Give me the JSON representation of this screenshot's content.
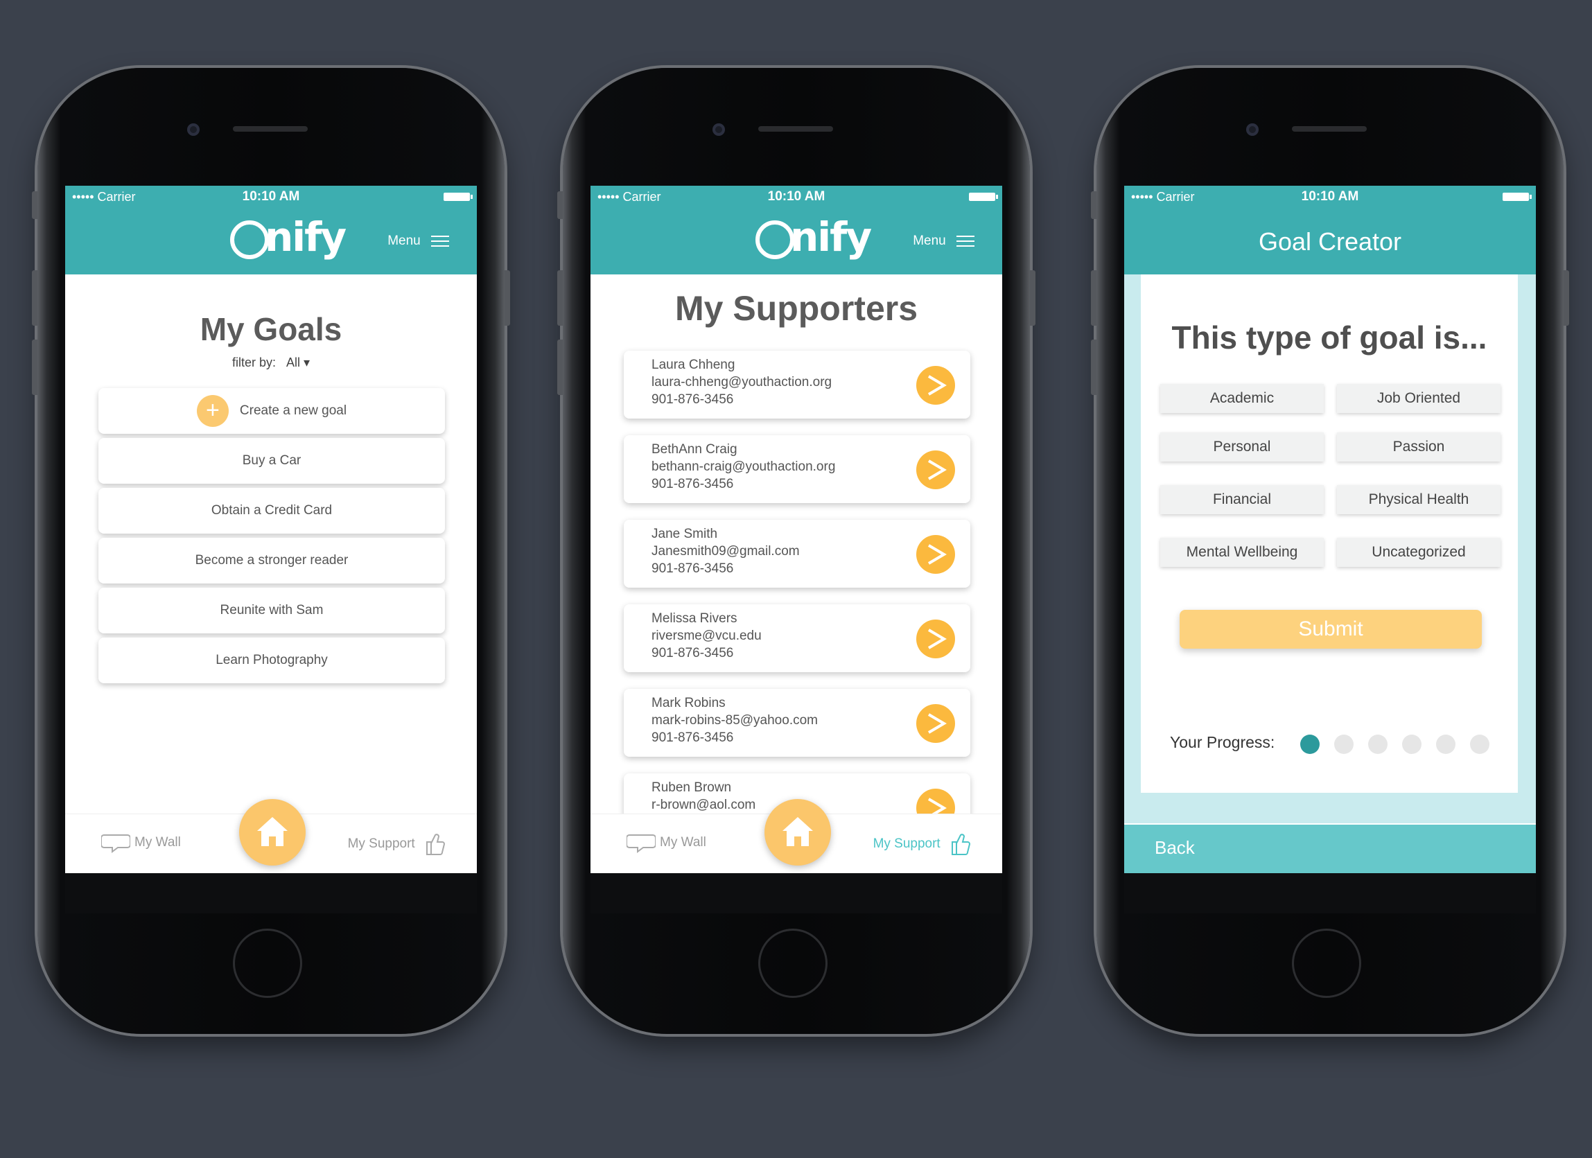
{
  "colors": {
    "background": "#3b414c",
    "teal": "#3daeb0",
    "accent": "#fbc66b",
    "active_dot": "#2c9a9c"
  },
  "status_bar": {
    "carrier": "••••• Carrier",
    "time": "10:10 AM"
  },
  "brand": {
    "logo_text": "nify",
    "menu_label": "Menu"
  },
  "screen1": {
    "title": "My Goals",
    "filter_label": "filter by:",
    "filter_value": "All ▾",
    "create_label": "Create a new goal",
    "goals": [
      "Buy a Car",
      "Obtain a Credit Card",
      "Become a stronger reader",
      "Reunite with Sam",
      "Learn Photography"
    ]
  },
  "screen2": {
    "title": "My Supporters",
    "supporters": [
      {
        "name": "Laura Chheng",
        "email": "laura-chheng@youthaction.org",
        "phone": "901-876-3456"
      },
      {
        "name": "BethAnn Craig",
        "email": "bethann-craig@youthaction.org",
        "phone": "901-876-3456"
      },
      {
        "name": "Jane Smith",
        "email": "Janesmith09@gmail.com",
        "phone": "901-876-3456"
      },
      {
        "name": "Melissa Rivers",
        "email": "riversme@vcu.edu",
        "phone": "901-876-3456"
      },
      {
        "name": "Mark Robins",
        "email": "mark-robins-85@yahoo.com",
        "phone": "901-876-3456"
      },
      {
        "name": "Ruben Brown",
        "email": "r-brown@aol.com",
        "phone": ""
      }
    ]
  },
  "screen3": {
    "header_title": "Goal Creator",
    "question": "This type of goal is...",
    "options": [
      "Academic",
      "Job Oriented",
      "Personal",
      "Passion",
      "Financial",
      "Physical Health",
      "Mental Wellbeing",
      "Uncategorized"
    ],
    "submit_label": "Submit",
    "progress_label": "Your Progress:",
    "progress_current": 1,
    "progress_total": 6,
    "back_label": "Back"
  },
  "nav": {
    "wall_label": "My Wall",
    "support_label": "My Support"
  }
}
